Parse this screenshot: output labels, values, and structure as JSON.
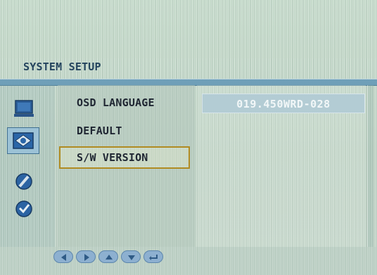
{
  "header": {
    "title": "SYSTEM SETUP"
  },
  "sidebar": {
    "icons": [
      {
        "name": "monitor-icon"
      },
      {
        "name": "picture-icon",
        "selected": true
      },
      {
        "name": "color-icon"
      },
      {
        "name": "clock-icon"
      }
    ]
  },
  "menu": {
    "items": [
      {
        "label": "OSD LANGUAGE",
        "selected": false
      },
      {
        "label": "DEFAULT",
        "selected": false
      },
      {
        "label": "S/W VERSION",
        "selected": true
      }
    ]
  },
  "value": {
    "text": "019.450WRD-028"
  },
  "footer": {
    "buttons": [
      {
        "name": "left-arrow-icon"
      },
      {
        "name": "right-arrow-icon"
      },
      {
        "name": "up-arrow-icon"
      },
      {
        "name": "down-arrow-icon"
      },
      {
        "name": "return-icon"
      }
    ]
  },
  "colors": {
    "title_text": "#24445e",
    "header_line": "#6f9fb8",
    "selection_border": "#b08b22",
    "nav_button": "#8db0d0"
  }
}
